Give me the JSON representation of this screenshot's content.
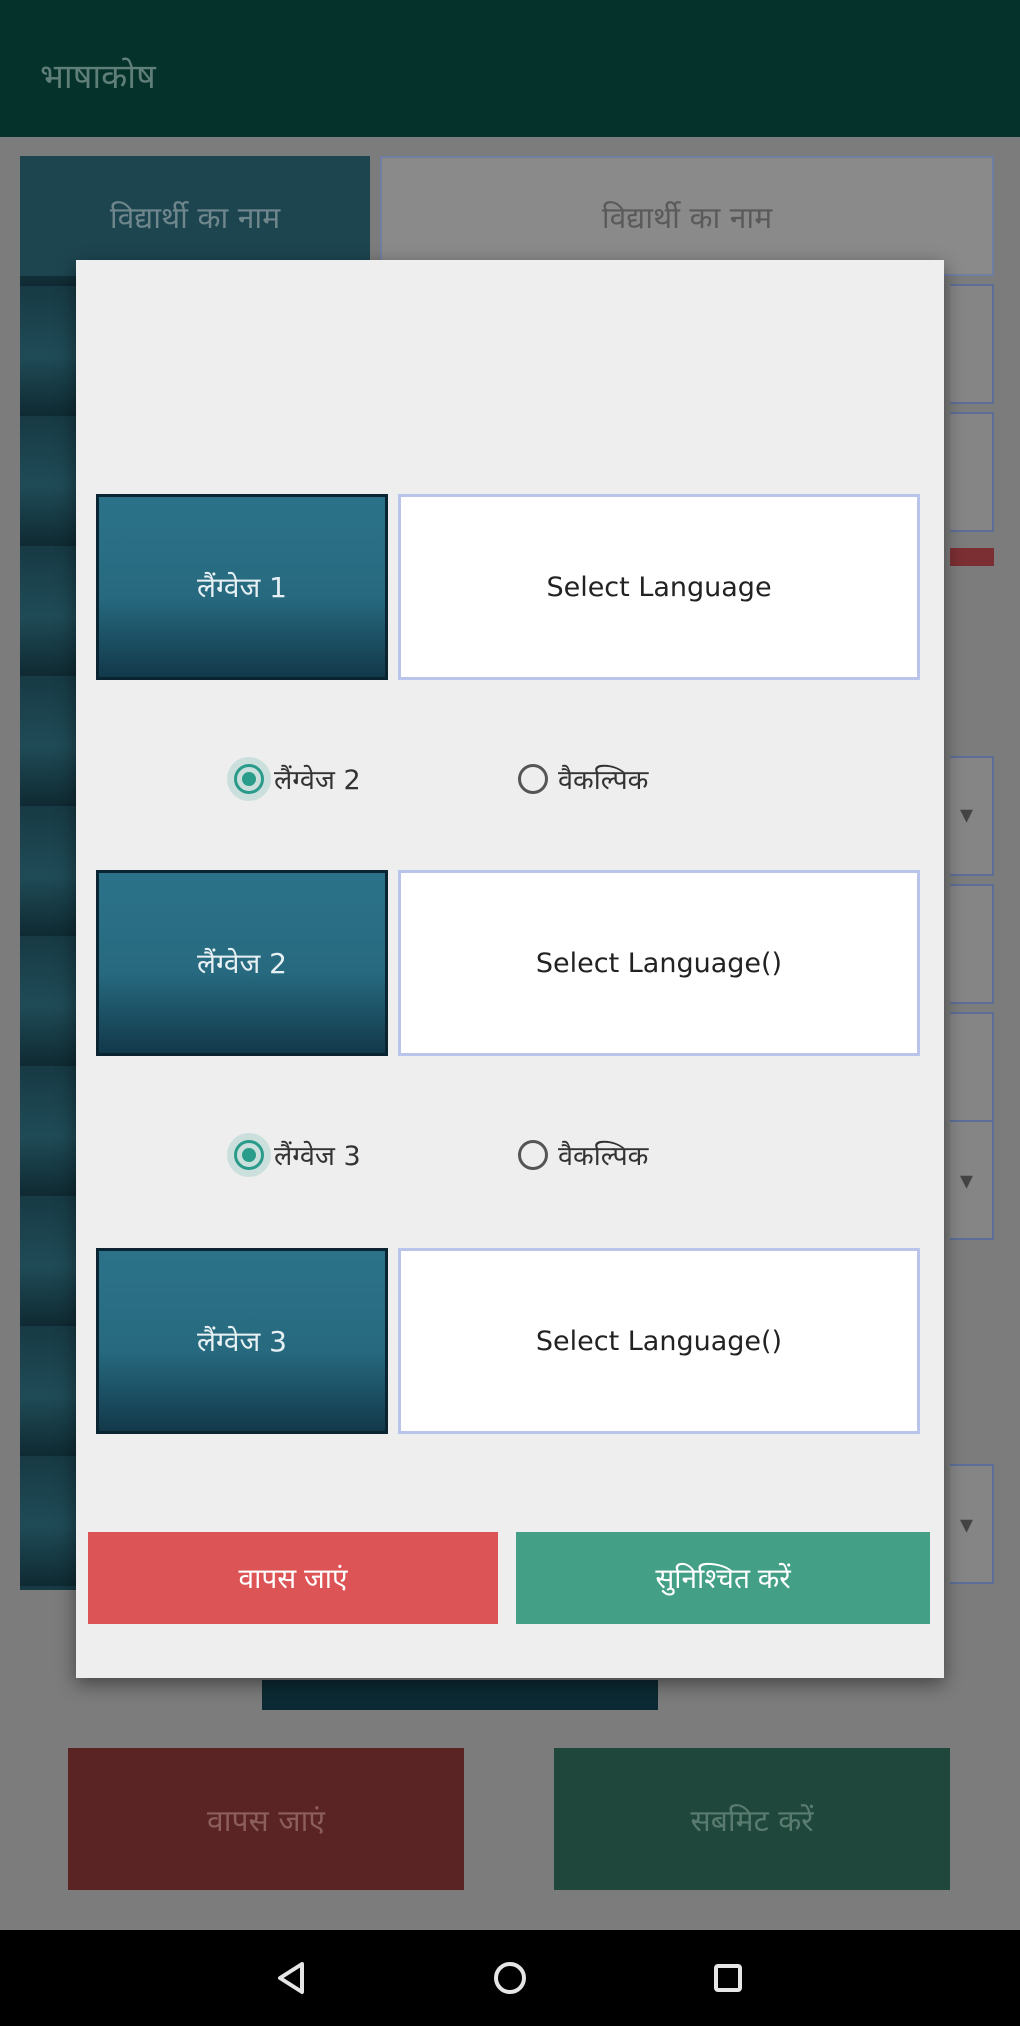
{
  "app": {
    "title": "भाषाकोष"
  },
  "background": {
    "header_left": "विद्यार्थी का नाम",
    "header_right": "विद्यार्थी का नाम",
    "cancel_button": "वापस जाएं",
    "ok_button": "सबमिट करें"
  },
  "dialog": {
    "rows": [
      {
        "label": "लैंग्वेज 1",
        "select_value": "Select Language"
      },
      {
        "label": "लैंग्वेज 2",
        "select_value": "Select Language()"
      },
      {
        "label": "लैंग्वेज 3",
        "select_value": "Select Language()"
      }
    ],
    "radio_groups": [
      {
        "option_a": "लैंग्वेज 2",
        "option_b": "वैकल्पिक",
        "selected": "option_a"
      },
      {
        "option_a": "लैंग्वेज 3",
        "option_b": "वैकल्पिक",
        "selected": "option_a"
      }
    ],
    "cancel_button": "वापस जाएं",
    "ok_button": "सुनिश्चित करें"
  },
  "navbar": {
    "icons": [
      "back-icon",
      "home-icon",
      "recents-icon"
    ]
  },
  "colors": {
    "appbar": "#05332c",
    "label_button": "#2b7289",
    "cancel": "#dc5456",
    "confirm": "#43a086",
    "radio_accent": "#2a9c8a"
  }
}
